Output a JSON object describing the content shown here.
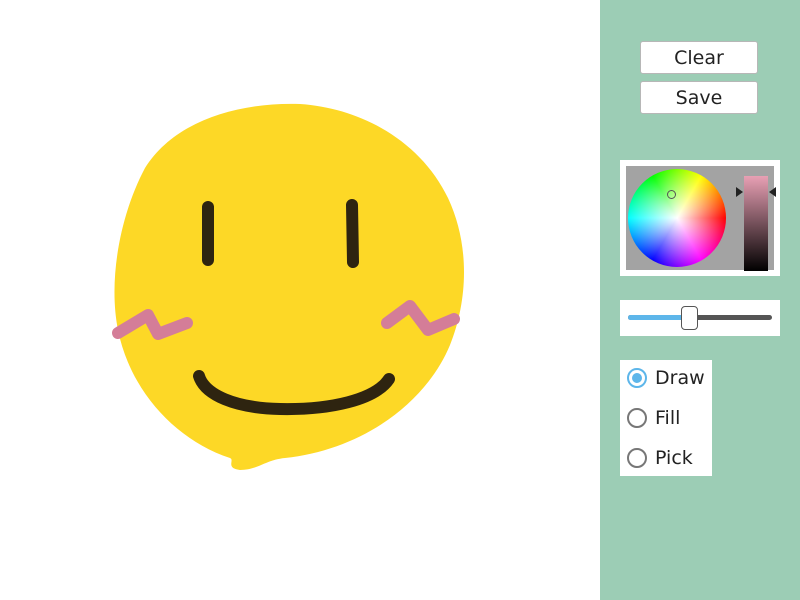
{
  "toolbar": {
    "clear_label": "Clear",
    "save_label": "Save"
  },
  "color_picker": {
    "selected_color": "#e8a0b4",
    "value_level": 0.18
  },
  "brush_size": {
    "value": 0.43
  },
  "tools": [
    {
      "label": "Draw",
      "checked": true
    },
    {
      "label": "Fill",
      "checked": false
    },
    {
      "label": "Pick",
      "checked": false
    }
  ],
  "colors": {
    "sidebar": "#9ccdb5",
    "face_yellow": "#fdd826",
    "feature_dark": "#2e2410",
    "cheek_pink": "#d47d98",
    "accent_blue": "#5db6ea"
  }
}
